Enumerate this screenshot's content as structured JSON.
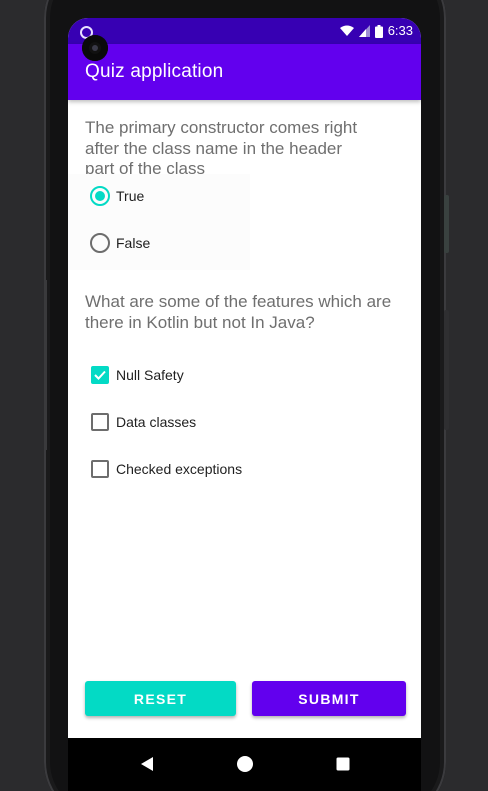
{
  "status_bar": {
    "time": "6:33",
    "wifi_icon": "wifi-icon",
    "signal_icon": "signal-icon",
    "battery_icon": "battery-icon",
    "notification_icon": "notification-dot-icon"
  },
  "app_bar": {
    "title": "Quiz application",
    "color": "#6200ee",
    "status_color": "#3700b3"
  },
  "question1": {
    "text": "The primary constructor comes right after the class name in the header part of the class",
    "type": "radio",
    "options": [
      {
        "label": "True",
        "checked": true
      },
      {
        "label": "False",
        "checked": false
      }
    ]
  },
  "question2": {
    "text": "What are some of the features which are there in Kotlin but not In Java?",
    "type": "checkbox",
    "options": [
      {
        "label": "Null Safety",
        "checked": true
      },
      {
        "label": "Data classes",
        "checked": false
      },
      {
        "label": "Checked exceptions",
        "checked": false
      }
    ]
  },
  "buttons": {
    "reset_label": "RESET",
    "submit_label": "SUBMIT",
    "reset_color": "#03dac5",
    "submit_color": "#6200ee"
  },
  "nav_bar": {
    "back_icon": "back-triangle-icon",
    "home_icon": "home-circle-icon",
    "recents_icon": "recents-square-icon"
  },
  "accent_color": "#03dac5"
}
